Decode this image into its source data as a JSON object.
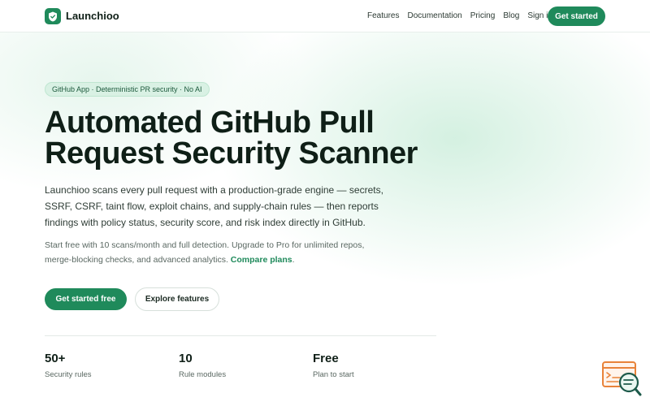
{
  "brand": {
    "name": "Launchioo",
    "accent": "#1f8a5b"
  },
  "nav": {
    "links": [
      "Features",
      "Documentation",
      "Pricing",
      "Blog",
      "Sign in"
    ],
    "cta": "Get started"
  },
  "hero": {
    "badge": "GitHub App · Deterministic PR security · No AI",
    "title_line1": "Automated GitHub Pull",
    "title_line2": "Request Security Scanner",
    "lead": "Launchioo scans every pull request with a production-grade engine — secrets, SSRF, CSRF, taint flow, exploit chains, and supply-chain rules — then reports findings with policy status, security score, and risk index directly in GitHub.",
    "sub_text": "Start free with 10 scans/month and full detection. Upgrade to Pro for unlimited repos, merge-blocking checks, and advanced analytics.",
    "sub_link": "Compare plans",
    "primary_button": "Get started free",
    "secondary_button": "Explore features"
  },
  "stats": [
    {
      "value": "50+",
      "label": "Security rules"
    },
    {
      "value": "10",
      "label": "Rule modules"
    },
    {
      "value": "Free",
      "label": "Plan to start"
    }
  ],
  "widget": {
    "icon": "chat-search-icon",
    "color": "#e8833a"
  }
}
